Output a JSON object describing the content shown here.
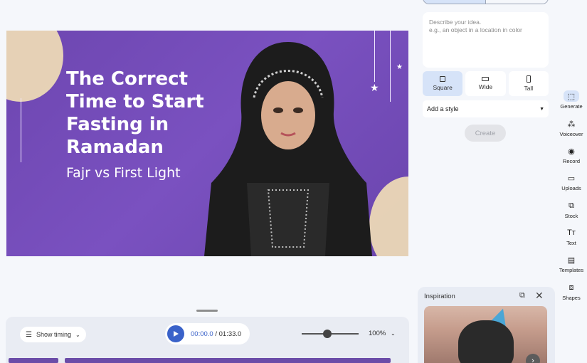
{
  "slide": {
    "title": "The Correct Time to Start Fasting in Ramadan",
    "subtitle": "Fajr vs First Light"
  },
  "timeline": {
    "show_timing_label": "Show timing",
    "current_time": "00:00.0",
    "total_time": "/ 01:33.0",
    "zoom_label": "100%",
    "zoom_level": 0.45
  },
  "generate_panel": {
    "prompt_placeholder_line1": "Describe your idea.",
    "prompt_placeholder_line2": "e.g., an object in a location in color",
    "ratios": [
      {
        "label": "Square",
        "icon": "square-icon",
        "selected": true
      },
      {
        "label": "Wide",
        "icon": "wide-rect-icon",
        "selected": false
      },
      {
        "label": "Tall",
        "icon": "tall-rect-icon",
        "selected": false
      }
    ],
    "style_select": "Add a style",
    "create_label": "Create"
  },
  "inspiration": {
    "title": "Inspiration"
  },
  "rail": [
    {
      "label": "Generate",
      "icon": "generate-icon",
      "glyph": "⬚",
      "selected": true
    },
    {
      "label": "Voiceover",
      "icon": "voiceover-icon",
      "glyph": "⁂",
      "selected": false
    },
    {
      "label": "Record",
      "icon": "record-icon",
      "glyph": "◉",
      "selected": false
    },
    {
      "label": "Uploads",
      "icon": "folder-icon",
      "glyph": "▭",
      "selected": false
    },
    {
      "label": "Stock",
      "icon": "stock-icon",
      "glyph": "⧉",
      "selected": false
    },
    {
      "label": "Text",
      "icon": "text-icon",
      "glyph": "Tт",
      "selected": false
    },
    {
      "label": "Templates",
      "icon": "templates-icon",
      "glyph": "▤",
      "selected": false
    },
    {
      "label": "Shapes",
      "icon": "shapes-icon",
      "glyph": "⧈",
      "selected": false
    }
  ],
  "colors": {
    "accent": "#3a62c9",
    "slide_purple": "#7a51c0",
    "selected_bg": "#d6e3f8"
  }
}
